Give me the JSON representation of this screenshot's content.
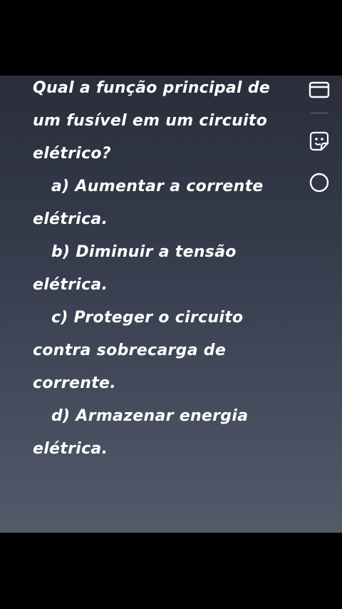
{
  "question": {
    "lines": [
      "Qual a função principal de",
      "um fusível em um circuito",
      "elétrico?"
    ]
  },
  "options": [
    {
      "lines": [
        "a) Aumentar a corrente",
        "elétrica."
      ]
    },
    {
      "lines": [
        "b) Diminuir a tensão",
        "elétrica."
      ]
    },
    {
      "lines": [
        "c) Proteger o circuito",
        "contra sobrecarga de",
        "corrente."
      ]
    },
    {
      "lines": [
        "d) Armazenar energia",
        "elétrica."
      ]
    }
  ],
  "side_toolbar": {
    "icons": [
      "window-icon",
      "sticker-icon",
      "circle-icon"
    ]
  },
  "colors": {
    "text": "#ffffff",
    "panel_top": "#2a2e3b",
    "panel_bottom": "#535a6a",
    "letterbox": "#000000"
  }
}
